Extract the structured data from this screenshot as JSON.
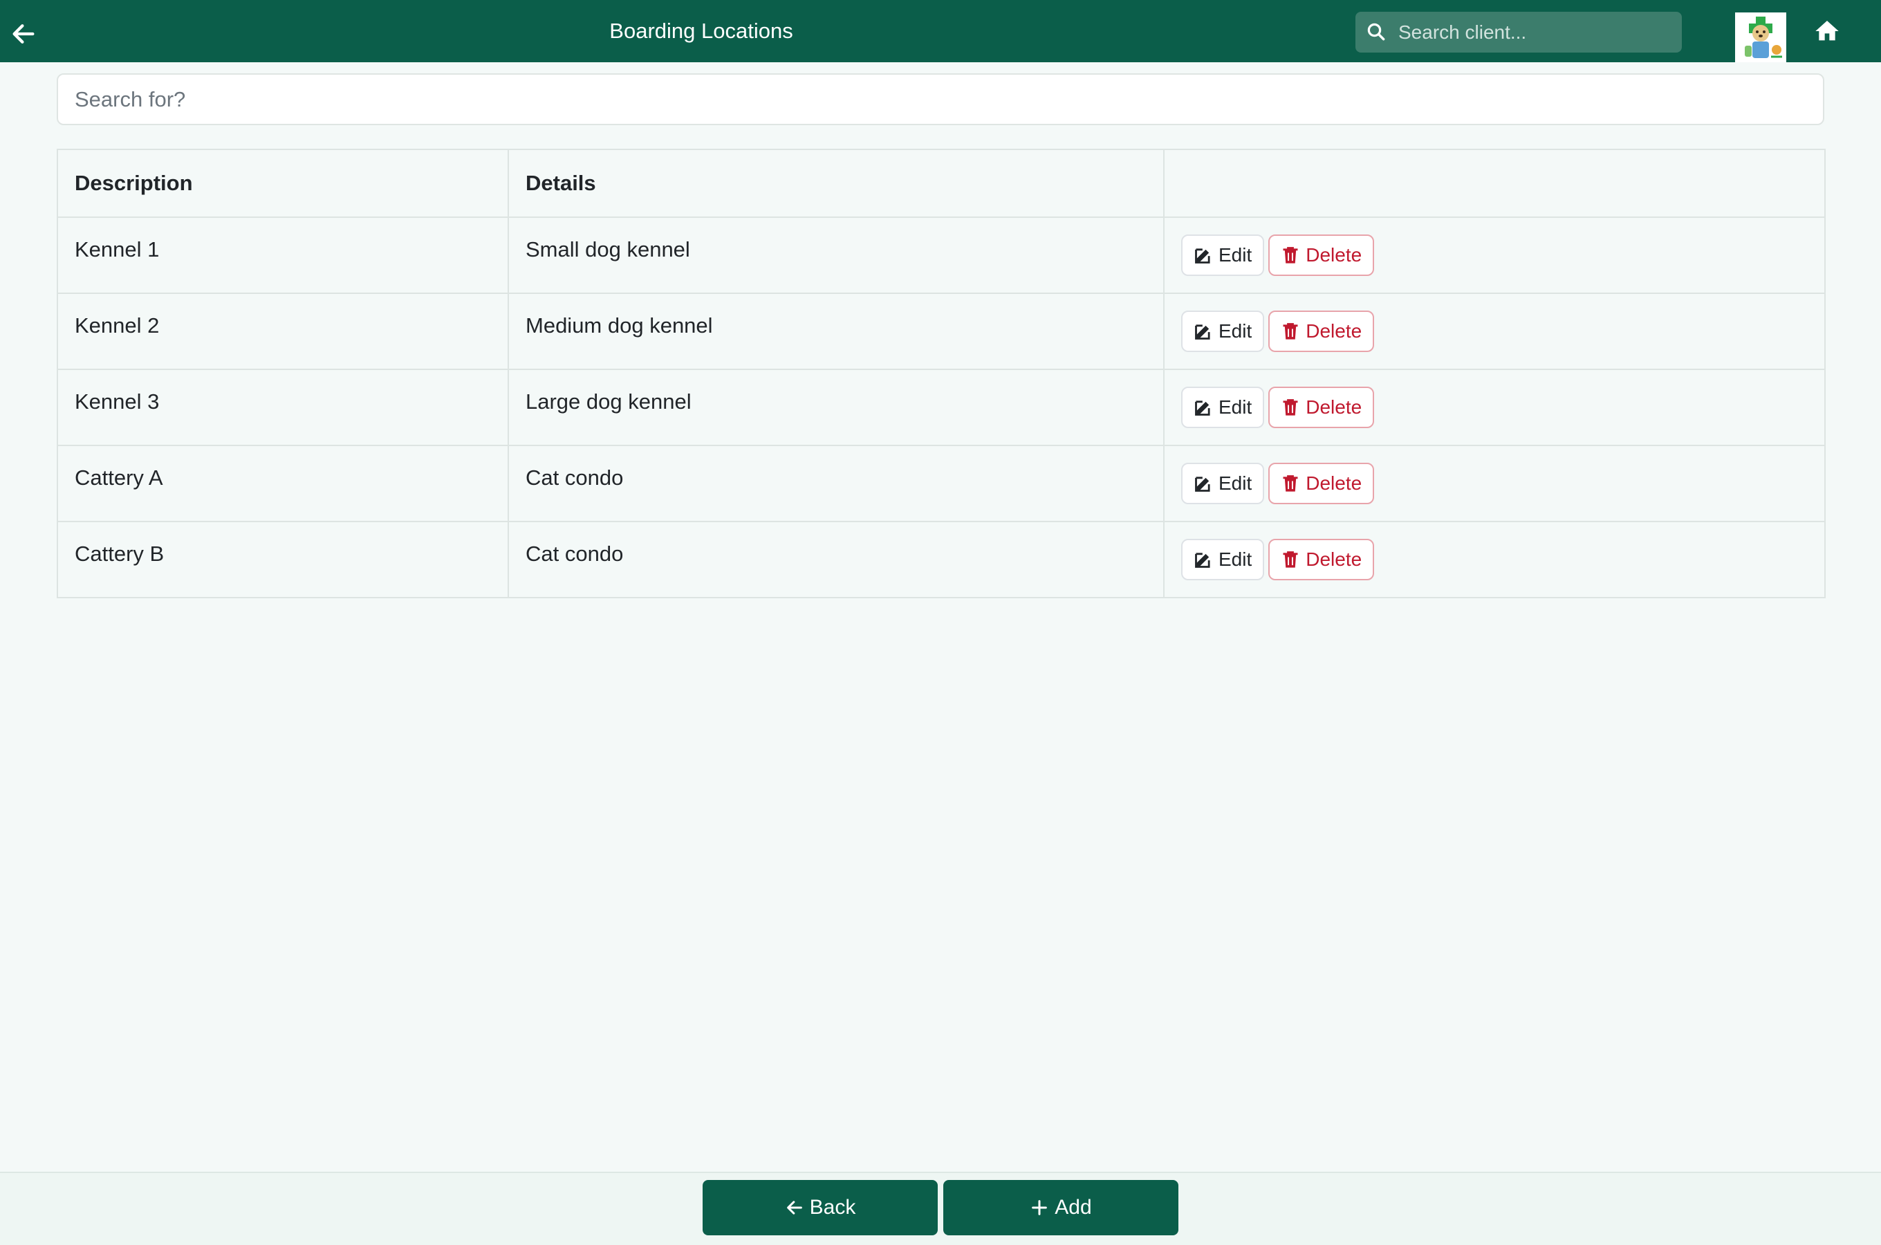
{
  "header": {
    "title": "Boarding Locations",
    "client_search_placeholder": "Search client..."
  },
  "table_search": {
    "placeholder": "Search for?"
  },
  "table": {
    "columns": [
      "Description",
      "Details",
      ""
    ],
    "rows": [
      {
        "description": "Kennel 1",
        "details": "Small dog kennel"
      },
      {
        "description": "Kennel 2",
        "details": "Medium dog kennel"
      },
      {
        "description": "Kennel 3",
        "details": "Large dog kennel"
      },
      {
        "description": "Cattery A",
        "details": "Cat condo"
      },
      {
        "description": "Cattery B",
        "details": "Cat condo"
      }
    ],
    "edit_label": "Edit",
    "delete_label": "Delete"
  },
  "footer": {
    "back_label": "Back",
    "add_label": "Add"
  },
  "icons": {
    "back": "arrow-left-icon",
    "search": "search-icon",
    "avatar": "clinic-logo",
    "home": "home-icon",
    "edit": "edit-icon",
    "delete": "trash-icon",
    "add": "plus-icon"
  },
  "colors": {
    "brand": "#0b5e4a",
    "danger": "#c0192e",
    "background": "#f4f9f8"
  }
}
